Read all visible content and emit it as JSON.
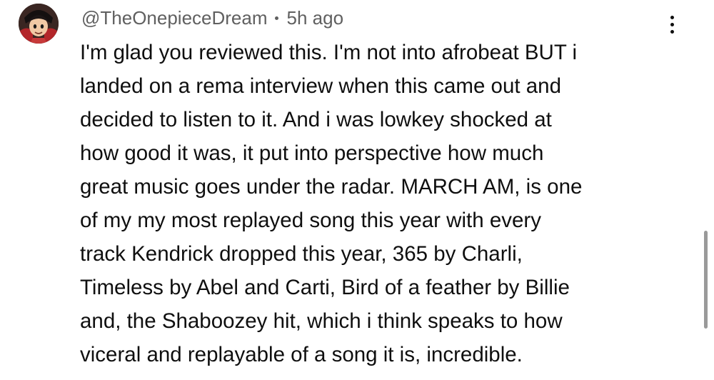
{
  "comment": {
    "author": "@TheOnepieceDream",
    "timestamp": "5h ago",
    "avatar_icon": "anime-character-avatar",
    "lines": [
      "I'm glad you reviewed this. I'm not into afrobeat BUT i",
      "landed on a rema interview when this came out and",
      "decided to listen to it. And i was lowkey shocked at",
      "how good it was, it put into perspective how much",
      "great music goes under the radar. MARCH AM, is one",
      "of my my most replayed song this year with every",
      "track Kendrick dropped this year, 365 by Charli,",
      "Timeless by Abel and Carti, Bird of a feather by Billie",
      "and, the Shaboozey hit, which i think speaks to how",
      "viceral and replayable of a song it is, incredible."
    ],
    "more_icon": "vertical-ellipsis-icon"
  },
  "colors": {
    "text_primary": "#0f0f0f",
    "text_secondary": "#606060",
    "scrollbar": "#9a9a9a"
  }
}
